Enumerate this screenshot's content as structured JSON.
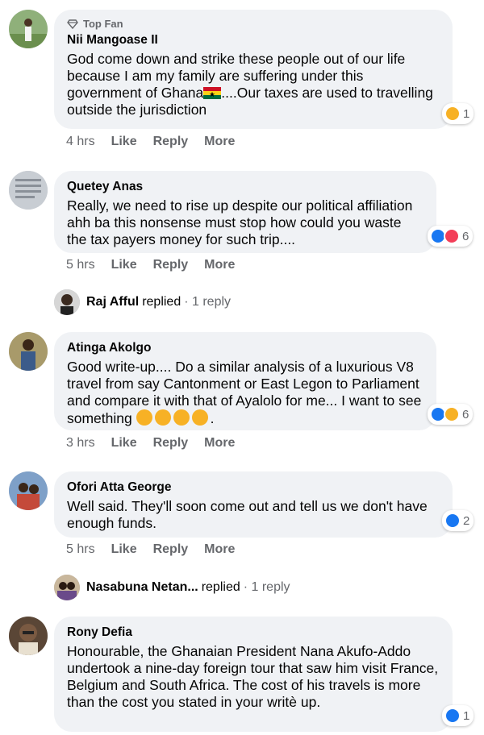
{
  "comments": [
    {
      "badge": "Top Fan",
      "author": "Nii Mangoase II",
      "text_before_flag": "God come down and strike these people out of our life because I am my family are suffering under this government of Ghana",
      "text_after_flag": "....Our taxes are used to travelling outside the jurisdiction",
      "time": "4 hrs",
      "like": "Like",
      "reply": "Reply",
      "more": "More",
      "reaction_count": "1",
      "reactions": [
        "haha"
      ]
    },
    {
      "author": "Quetey Anas",
      "text": "Really, we need to rise up despite our political affiliation ahh ba this nonsense must stop how could you waste the tax payers money for such trip....",
      "time": "5 hrs",
      "like": "Like",
      "reply": "Reply",
      "more": "More",
      "reaction_count": "6",
      "reactions": [
        "like",
        "love"
      ],
      "replies": {
        "name": "Raj Afful",
        "verb": "replied",
        "count": "· 1 reply"
      }
    },
    {
      "author": "Atinga Akolgo",
      "text": "Good write-up.... Do a similar analysis of a luxurious V8 travel from say Cantonment or East Legon to Parliament and compare it with that of Ayalolo for me... I want to see something",
      "text_end": ".",
      "time": "3 hrs",
      "like": "Like",
      "reply": "Reply",
      "more": "More",
      "reaction_count": "6",
      "reactions": [
        "like",
        "haha"
      ]
    },
    {
      "author": "Ofori Atta George",
      "text": "Well said. They'll soon come out and tell us we don't have enough funds.",
      "time": "5 hrs",
      "like": "Like",
      "reply": "Reply",
      "more": "More",
      "reaction_count": "2",
      "reactions": [
        "like"
      ],
      "replies": {
        "name": "Nasabuna Netan...",
        "verb": "replied",
        "count": "· 1 reply"
      }
    },
    {
      "author": "Rony Defia",
      "text": "Honourable, the Ghanaian President Nana Akufo-Addo undertook a nine-day foreign tour that saw him visit France, Belgium and South Africa. The cost of his travels is more than the cost you stated in your writè up.",
      "reaction_count": "1",
      "reactions": [
        "like"
      ]
    }
  ],
  "colors": {
    "bubble": "#f0f2f5",
    "muted": "#65676b",
    "like_blue": "#1877f2",
    "love_red": "#f33e58",
    "haha_yellow": "#f7b125"
  }
}
